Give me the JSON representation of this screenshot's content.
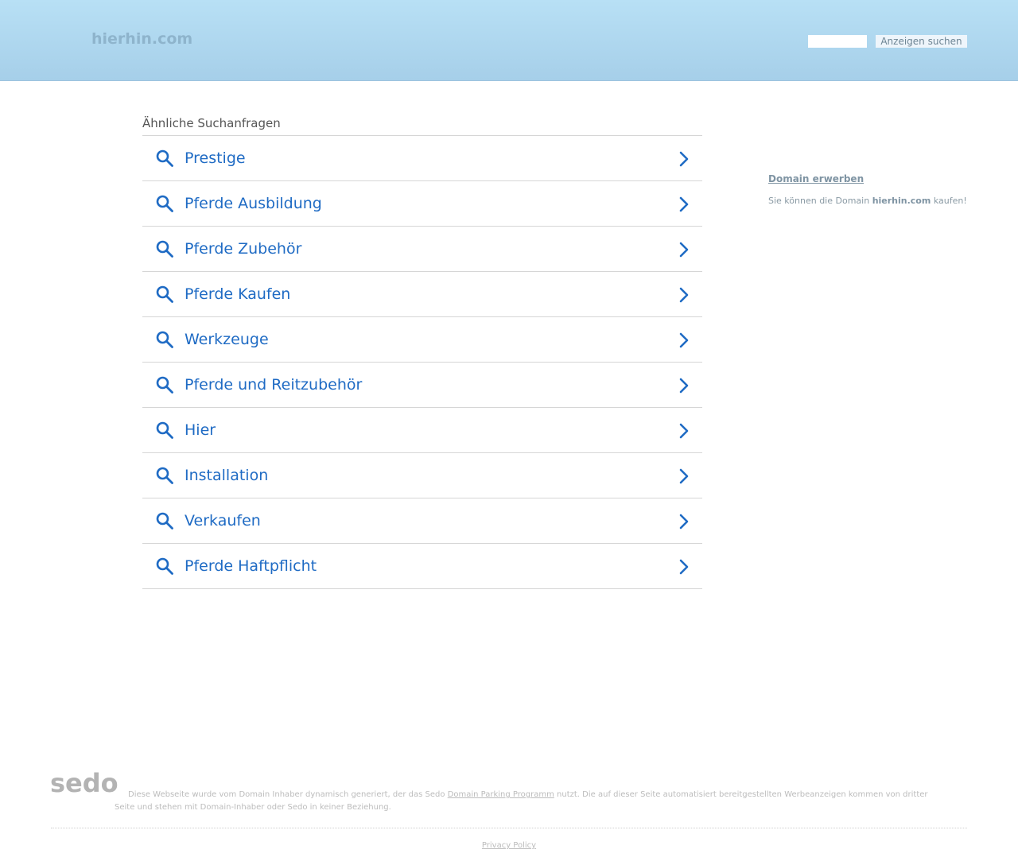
{
  "header": {
    "logo": "hierhin.com",
    "search_placeholder": "",
    "search_button_label": "Anzeigen suchen"
  },
  "related": {
    "title": "Ähnliche Suchanfragen",
    "items": [
      {
        "label": "Prestige"
      },
      {
        "label": "Pferde Ausbildung"
      },
      {
        "label": "Pferde Zubehör"
      },
      {
        "label": "Pferde Kaufen"
      },
      {
        "label": "Werkzeuge"
      },
      {
        "label": "Pferde und Reitzubehör"
      },
      {
        "label": "Hier"
      },
      {
        "label": "Installation"
      },
      {
        "label": "Verkaufen"
      },
      {
        "label": "Pferde Haftpflicht"
      }
    ]
  },
  "sidebar": {
    "title": "Domain erwerben",
    "text_before": "Sie können die Domain ",
    "domain": "hierhin.com",
    "text_after": " kaufen!"
  },
  "footer": {
    "logo": "sedo",
    "disclaimer_part1": "Diese Webseite wurde vom Domain Inhaber dynamisch generiert, der das Sedo ",
    "disclaimer_link": "Domain Parking Programm",
    "disclaimer_part2": " nutzt. Die auf dieser Seite automatisiert bereitgestellten Werbeanzeigen kommen von dritter Seite und stehen mit Domain-Inhaber oder Sedo in keiner Beziehung.",
    "privacy_link": "Privacy Policy"
  },
  "colors": {
    "header_top": "#b8e0f5",
    "header_bottom": "#a6cfe9",
    "link_blue": "#1f6bc4",
    "divider": "#d6d6d6"
  }
}
